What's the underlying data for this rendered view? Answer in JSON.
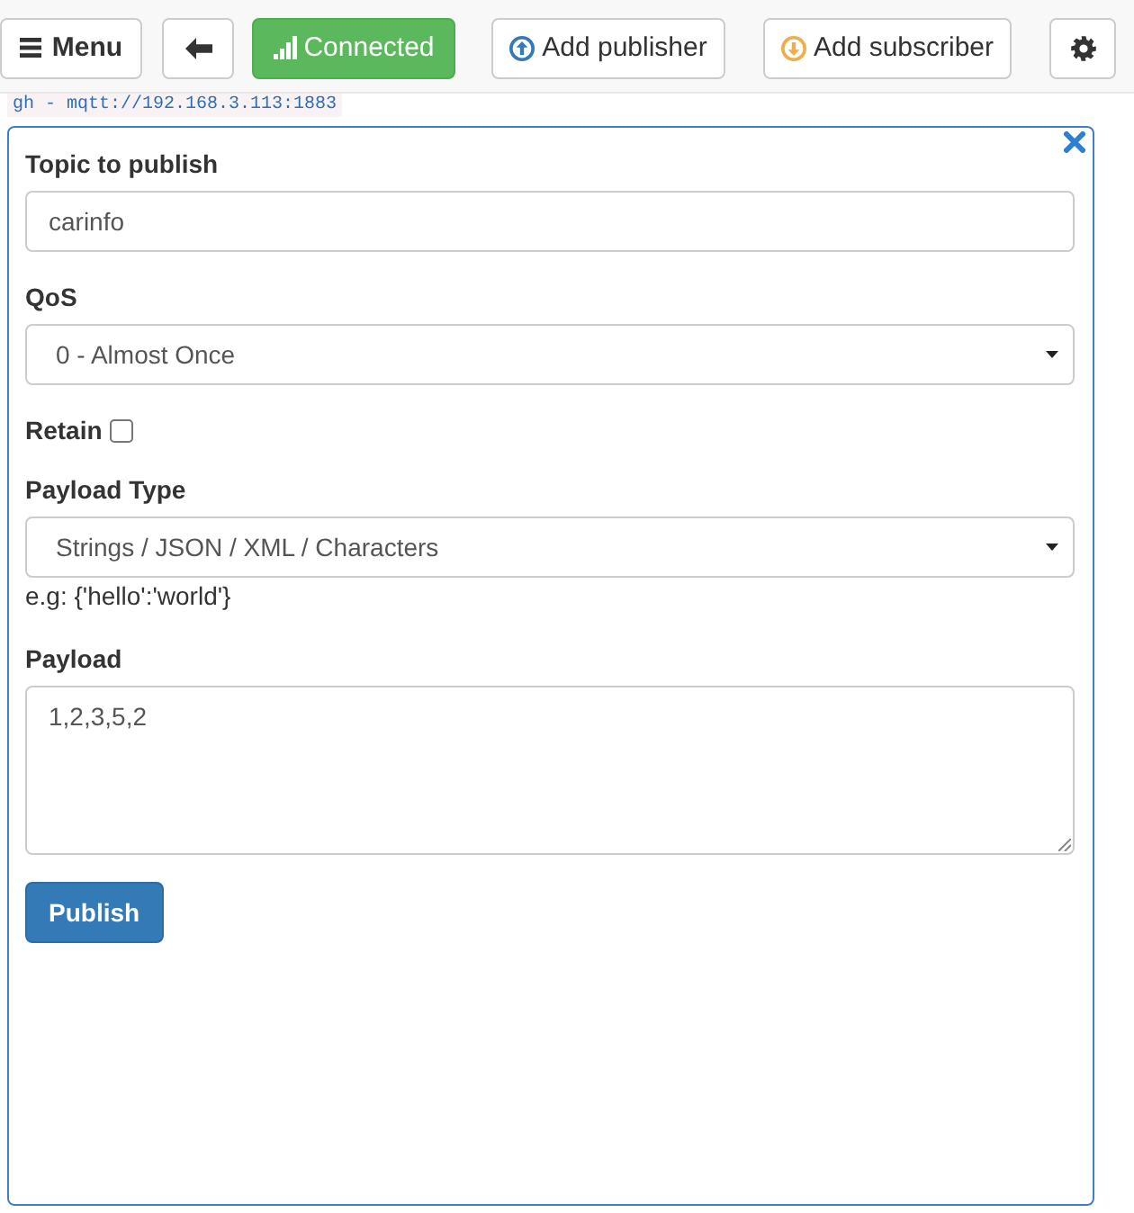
{
  "toolbar": {
    "buttons": [
      {
        "kind": "menu",
        "label": "Menu"
      },
      {
        "kind": "back"
      },
      {
        "kind": "status",
        "label": "Connected",
        "connected": true
      },
      {
        "kind": "add-publisher",
        "label": "Add publisher"
      },
      {
        "kind": "add-subscriber",
        "label": "Add subscriber"
      },
      {
        "kind": "settings"
      }
    ]
  },
  "connection_label": "gh - mqtt://192.168.3.113:1883",
  "publisher": {
    "fields": [
      {
        "kind": "text",
        "label": "Topic to publish",
        "value": "carinfo"
      },
      {
        "kind": "select",
        "label": "QoS",
        "value": "0 - Almost Once"
      },
      {
        "kind": "checkbox",
        "label": "Retain",
        "checked": false
      },
      {
        "kind": "select",
        "label": "Payload Type",
        "value": "Strings / JSON / XML / Characters",
        "hint": "e.g: {'hello':'world'}"
      },
      {
        "kind": "textarea",
        "label": "Payload",
        "value": "1,2,3,5,2"
      }
    ],
    "button": "Publish"
  }
}
